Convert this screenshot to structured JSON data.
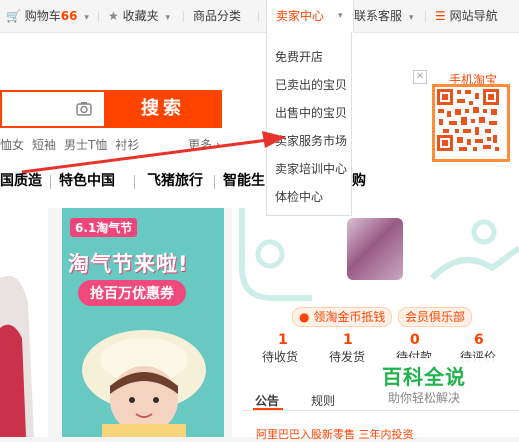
{
  "topbar": {
    "cart_label": "购物车",
    "cart_count": "66",
    "favorites_label": "收藏夹",
    "categories_label": "商品分类",
    "seller_center_label": "卖家中心",
    "support_label": "联系客服",
    "site_nav_label": "网站导航"
  },
  "seller_menu": {
    "items": [
      "免费开店",
      "已卖出的宝贝",
      "出售中的宝贝",
      "卖家服务市场",
      "卖家培训中心",
      "体检中心"
    ]
  },
  "search": {
    "button_label": "搜索",
    "hot_words": [
      "恤女",
      "短袖",
      "男士T恤",
      "衬衫"
    ],
    "more_label": "更多"
  },
  "nav": {
    "items": [
      "国质造",
      "特色中国",
      "飞猪旅行",
      "智能生",
      "购"
    ]
  },
  "qr": {
    "title": "手机淘宝"
  },
  "banner": {
    "logo": "6.1淘气节",
    "headline": "淘气节来啦!",
    "subline": "抢百万优惠券"
  },
  "user": {
    "badges": [
      "领淘金币抵钱",
      "会员俱乐部"
    ],
    "counts": [
      {
        "num": "1",
        "label": "待收货"
      },
      {
        "num": "1",
        "label": "待发货"
      },
      {
        "num": "0",
        "label": "待付款"
      },
      {
        "num": "6",
        "label": "待评价"
      }
    ],
    "tabs": [
      "公告",
      "规则"
    ],
    "news": "阿里巴巴入股新零售 三年内投资"
  },
  "watermark": {
    "title": "百科全说",
    "subtitle": "助你轻松解决"
  },
  "colors": {
    "accent": "#ff4400",
    "banner": "#67c9c2",
    "watermark": "#21b24b",
    "arrow": "#e8322c"
  }
}
